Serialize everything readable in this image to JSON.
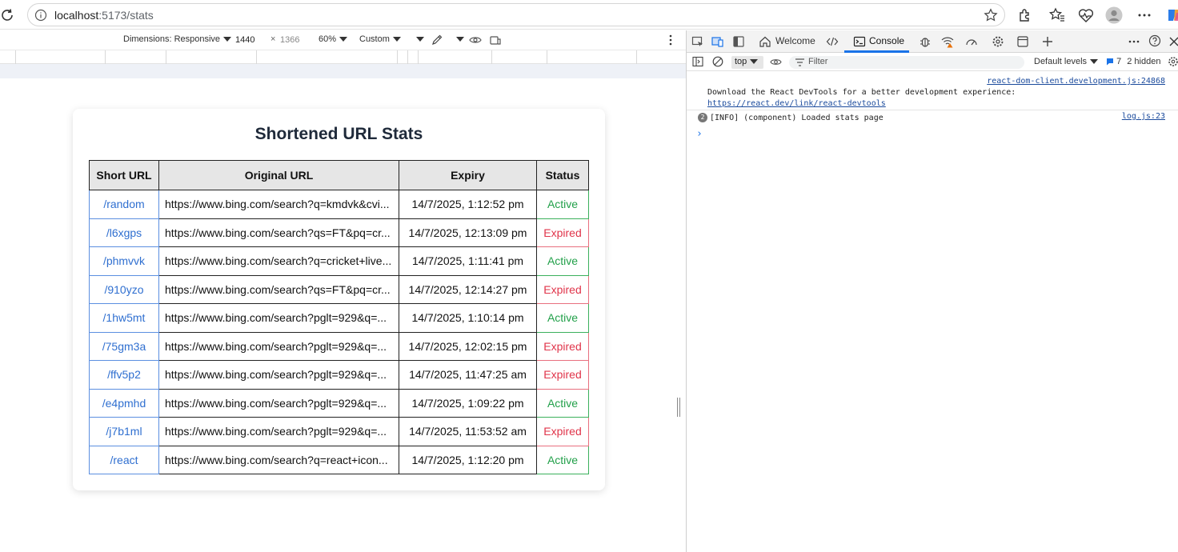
{
  "browser": {
    "url_host": "localhost",
    "url_path": ":5173/stats"
  },
  "device_toolbar": {
    "dimensions_label": "Dimensions: Responsive",
    "width": "1440",
    "times": "×",
    "height": "1366",
    "zoom": "60%",
    "throttle": "Custom"
  },
  "page": {
    "title": "Shortened URL Stats",
    "columns": [
      "Short URL",
      "Original URL",
      "Expiry",
      "Status"
    ],
    "rows": [
      {
        "short": "/random",
        "original": "https://www.bing.com/search?q=kmdvk&cvi...",
        "expiry": "14/7/2025, 1:12:52 pm",
        "status": "Active"
      },
      {
        "short": "/l6xgps",
        "original": "https://www.bing.com/search?qs=FT&pq=cr...",
        "expiry": "14/7/2025, 12:13:09 pm",
        "status": "Expired"
      },
      {
        "short": "/phmvvk",
        "original": "https://www.bing.com/search?q=cricket+live...",
        "expiry": "14/7/2025, 1:11:41 pm",
        "status": "Active"
      },
      {
        "short": "/910yzo",
        "original": "https://www.bing.com/search?qs=FT&pq=cr...",
        "expiry": "14/7/2025, 12:14:27 pm",
        "status": "Expired"
      },
      {
        "short": "/1hw5mt",
        "original": "https://www.bing.com/search?pglt=929&q=...",
        "expiry": "14/7/2025, 1:10:14 pm",
        "status": "Active"
      },
      {
        "short": "/75gm3a",
        "original": "https://www.bing.com/search?pglt=929&q=...",
        "expiry": "14/7/2025, 12:02:15 pm",
        "status": "Expired"
      },
      {
        "short": "/ffv5p2",
        "original": "https://www.bing.com/search?pglt=929&q=...",
        "expiry": "14/7/2025, 11:47:25 am",
        "status": "Expired"
      },
      {
        "short": "/e4pmhd",
        "original": "https://www.bing.com/search?pglt=929&q=...",
        "expiry": "14/7/2025, 1:09:22 pm",
        "status": "Active"
      },
      {
        "short": "/j7b1ml",
        "original": "https://www.bing.com/search?pglt=929&q=...",
        "expiry": "14/7/2025, 11:53:52 am",
        "status": "Expired"
      },
      {
        "short": "/react",
        "original": "https://www.bing.com/search?q=react+icon...",
        "expiry": "14/7/2025, 1:12:20 pm",
        "status": "Active"
      }
    ]
  },
  "devtools": {
    "tabs": {
      "welcome": "Welcome",
      "console": "Console"
    },
    "context": "top",
    "filter_placeholder": "Filter",
    "levels": "Default levels",
    "issues_count": "7",
    "hidden": "2 hidden",
    "messages": [
      {
        "source": "react-dom-client.development.js:24868",
        "text": "Download the React DevTools for a better development experience:",
        "link": "https://react.dev/link/react-devtools"
      },
      {
        "count": "2",
        "text": "[INFO] (component) Loaded stats page",
        "source": "log.js:23"
      }
    ],
    "prompt": "›"
  },
  "colors": {
    "active": "#22a04a",
    "expired": "#e0344a",
    "link": "#2f6fd0",
    "accent": "#1a73e8"
  }
}
